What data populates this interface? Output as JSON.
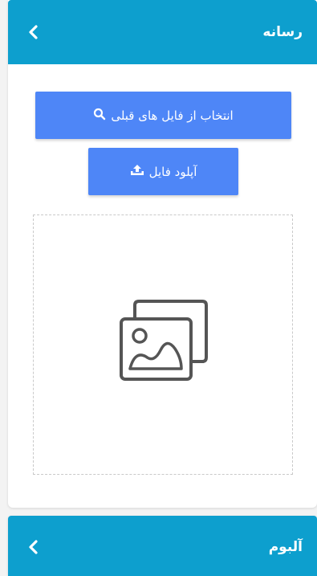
{
  "media_panel": {
    "title": "رسانه",
    "select_button_label": "انتخاب از فایل های قبلی",
    "upload_button_label": "آپلود فایل"
  },
  "album_panel": {
    "title": "آلبوم"
  },
  "icons": {
    "collapse": "chevron-left-icon",
    "search": "search-icon",
    "upload": "upload-icon",
    "placeholder": "image-placeholder-icon"
  },
  "colors": {
    "header": "#0d9fce",
    "button": "#4e86f7",
    "placeholder_stroke": "#555555"
  }
}
